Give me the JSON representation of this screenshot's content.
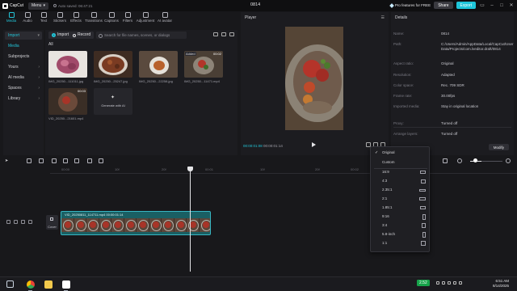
{
  "titlebar": {
    "app_name": "CapCut",
    "menu_label": "Menu",
    "autosave": "Auto saved: 06:47:21",
    "project_title": "0814",
    "pro_label": "Pro features for FREE",
    "share_label": "Share",
    "export_label": "Export"
  },
  "tool_tabs": [
    {
      "label": "Media"
    },
    {
      "label": "Audio"
    },
    {
      "label": "Text"
    },
    {
      "label": "Stickers"
    },
    {
      "label": "Effects"
    },
    {
      "label": "Transitions"
    },
    {
      "label": "Captions"
    },
    {
      "label": "Filters"
    },
    {
      "label": "Adjustment"
    },
    {
      "label": "AI avatar"
    }
  ],
  "left_nav": {
    "import": "Import",
    "media": "Media",
    "subprojects": "Subprojects",
    "yours": "Yours",
    "ai_media": "AI media",
    "spaces": "Spaces",
    "library": "Library"
  },
  "media_panel": {
    "import_label": "Import",
    "record_label": "Record",
    "search_placeholder": "Search for file names, scenes, or dialogs",
    "all_label": "All",
    "items": [
      {
        "label": "IMG_20250...111011.jpg"
      },
      {
        "label": "IMG_20250...25247.jpg"
      },
      {
        "label": "IMG_20250...22258.jpg"
      },
      {
        "label": "IMG_20250...11471.mp4",
        "badge": "Added",
        "duration": "00:02"
      },
      {
        "label": "VID_20250...21601.mp4",
        "duration": "00:03"
      }
    ],
    "generate_label": "Generate with AI"
  },
  "player": {
    "title": "Player",
    "current_time": "00:00:01:08",
    "total_time": "00:00:01:14"
  },
  "details": {
    "title": "Details",
    "rows": [
      {
        "key": "Name:",
        "value": "0814"
      },
      {
        "key": "Path:",
        "value": "C:/Users/Admin/AppData/Local/CapCut/User Data/Projects/com.lveditor.draft/0814"
      },
      {
        "key": "Aspect ratio:",
        "value": "Original"
      },
      {
        "key": "Resolution:",
        "value": "Adapted"
      },
      {
        "key": "Color space:",
        "value": "Rec. 709 SDR"
      },
      {
        "key": "Frame rate:",
        "value": "30.00fps"
      },
      {
        "key": "Imported media:",
        "value": "Stay in original location"
      },
      {
        "key": "Proxy:",
        "value": "Turned off"
      },
      {
        "key": "Arrange layers:",
        "value": "Turned off"
      }
    ],
    "modify_label": "Modify"
  },
  "timeline": {
    "ruler": [
      "00:00",
      "10f",
      "20f",
      "00:01",
      "10f",
      "20f",
      "00:02"
    ],
    "clip_label": "VID_20250811_114711.mp4   00:00:01:14",
    "cover_label": "Cover"
  },
  "ratio_menu": {
    "items": [
      {
        "label": "Original",
        "checked": true
      },
      {
        "label": "Custom"
      },
      {
        "label": "16:9"
      },
      {
        "label": "4:3"
      },
      {
        "label": "2.35:1"
      },
      {
        "label": "2:1"
      },
      {
        "label": "1.85:1"
      },
      {
        "label": "9:16"
      },
      {
        "label": "3:4"
      },
      {
        "label": "5.8-inch"
      },
      {
        "label": "1:1"
      }
    ]
  },
  "taskbar": {
    "stock": "2.52",
    "time": "6:51 AM",
    "date": "8/14/2025"
  },
  "colors": {
    "accent": "#1ec5d9",
    "clip_bg": "#1a5f63",
    "stock_green": "#16a34a"
  }
}
